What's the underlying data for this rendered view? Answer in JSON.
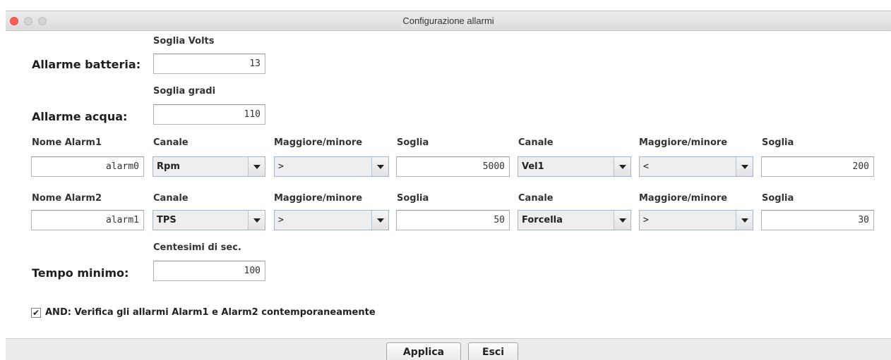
{
  "window": {
    "title": "Configurazione allarmi"
  },
  "battery": {
    "label": "Allarme batteria:",
    "header": "Soglia Volts",
    "value": "13"
  },
  "water": {
    "label": "Allarme acqua:",
    "header": "Soglia gradi",
    "value": "110"
  },
  "alarm_headers": {
    "canale": "Canale",
    "maggiore_minore": "Maggiore/minore",
    "soglia": "Soglia"
  },
  "alarm1": {
    "name_header": "Nome Alarm1",
    "name": "alarm0",
    "canale_a": "Rpm",
    "cmp_a": ">",
    "soglia_a": "5000",
    "canale_b": "Vel1",
    "cmp_b": "<",
    "soglia_b": "200"
  },
  "alarm2": {
    "name_header": "Nome Alarm2",
    "name": "alarm1",
    "canale_a": "TPS",
    "cmp_a": ">",
    "soglia_a": "50",
    "canale_b": "Forcella",
    "cmp_b": ">",
    "soglia_b": "30"
  },
  "min_time": {
    "label": "Tempo minimo:",
    "header": "Centesimi di sec.",
    "value": "100"
  },
  "and_option": {
    "checked": true,
    "label": "AND: Verifica gli allarmi Alarm1 e Alarm2 contemporaneamente"
  },
  "buttons": {
    "apply": "Applica",
    "exit": "Esci"
  }
}
